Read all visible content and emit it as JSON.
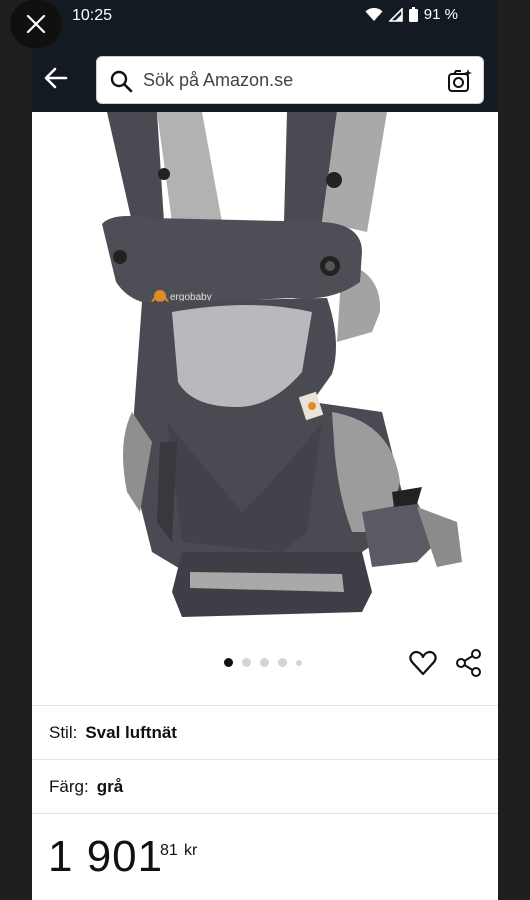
{
  "status_bar": {
    "time": "10:25",
    "battery": "91 %",
    "icons": [
      "wifi-icon",
      "signal-icon",
      "battery-icon"
    ]
  },
  "header": {
    "back_icon": "arrow-left-icon",
    "search": {
      "placeholder": "Sök på Amazon.se",
      "value": ""
    },
    "camera_icon": "camera-search-icon"
  },
  "overlay": {
    "close_icon": "close-icon"
  },
  "product": {
    "image_alt": "ergobaby",
    "carousel": {
      "count": 5,
      "active_index": 0
    },
    "style": {
      "label": "Stil:",
      "value": "Sval luftnät"
    },
    "color": {
      "label": "Färg:",
      "value": "grå"
    },
    "price": {
      "whole": "1 901",
      "fraction": "81",
      "currency": "kr"
    }
  },
  "colors": {
    "header_bg": "#131a22",
    "carrier_dark": "#4a4a52",
    "mesh_gray": "#a9a9a9",
    "logo_orange": "#e08a2a"
  }
}
